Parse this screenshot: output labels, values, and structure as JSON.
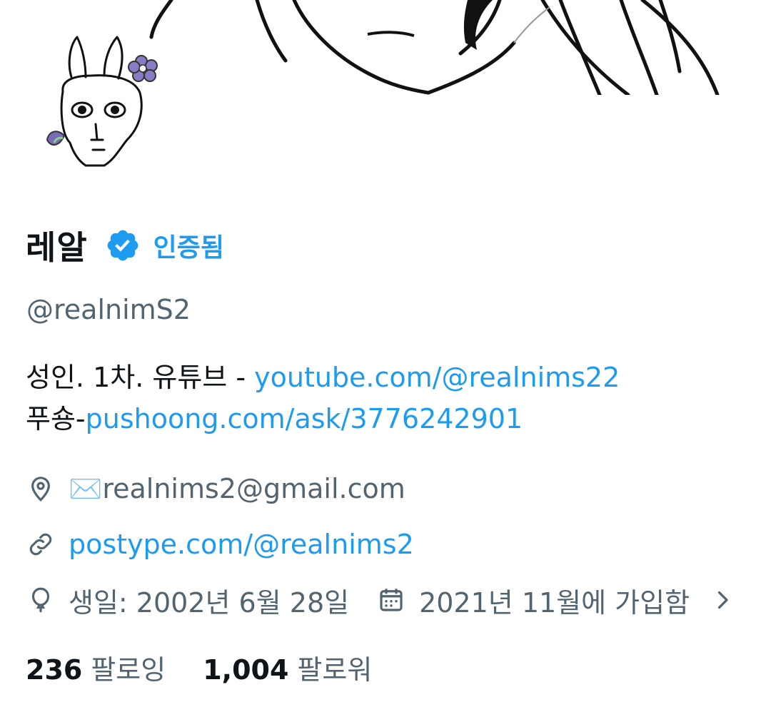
{
  "profile": {
    "display_name": "레알",
    "verified_label": "인증됨",
    "handle": "@realnimS2",
    "bio": {
      "line1_text": "성인. 1차. 유튜브 - ",
      "line1_link": "youtube.com/@realnims22",
      "line2_text": "푸숑-",
      "line2_link": "pushoong.com/ask/3776242901"
    },
    "location": "✉️realnims2@gmail.com",
    "website": "postype.com/@realnims2",
    "birthday": "생일: 2002년 6월 28일",
    "joined": "2021년 11월에 가입함",
    "following_count": "236",
    "following_label": "팔로잉",
    "followers_count": "1,004",
    "followers_label": "팔로워"
  },
  "colors": {
    "accent": "#1d9bf0",
    "secondary_text": "#536471",
    "primary_text": "#0f1419"
  },
  "icons": {
    "verified": "verified-badge-icon",
    "location": "location-pin-icon",
    "website": "link-icon",
    "birthday": "balloon-icon",
    "joined": "calendar-icon",
    "more": "chevron-right-icon"
  }
}
